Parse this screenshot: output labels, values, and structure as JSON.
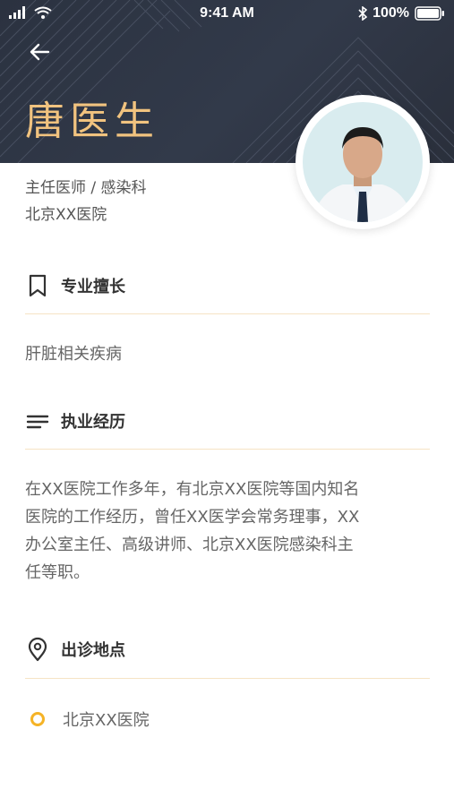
{
  "status_bar": {
    "time": "9:41 AM",
    "battery": "100%"
  },
  "doctor": {
    "name": "唐医生",
    "title_dept": "主任医师 / 感染科",
    "hospital": "北京XX医院"
  },
  "sections": {
    "specialty": {
      "title": "专业擅长",
      "content": "肝脏相关疾病"
    },
    "experience": {
      "title": "执业经历",
      "lines": [
        "在XX医院工作多年，有北京XX医院等国内知名",
        "医院的工作经历，曾任XX医学会常务理事，XX",
        "办公室主任、高级讲师、北京XX医院感染科主",
        "任等职。"
      ]
    },
    "location": {
      "title": "出诊地点",
      "item": "北京XX医院"
    }
  },
  "colors": {
    "header_bg": "#2b3240",
    "accent_gold": "#f1c37f",
    "divider": "#f6e3c4",
    "dot": "#f5b326"
  }
}
